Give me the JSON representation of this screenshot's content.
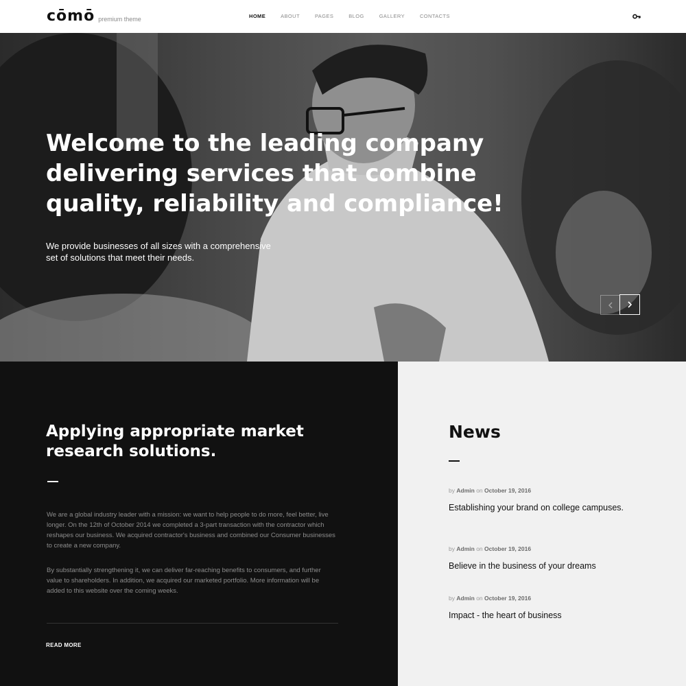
{
  "header": {
    "logo_text": "cōmō",
    "logo_tagline": "premium theme",
    "nav": [
      {
        "label": "HOME",
        "active": true
      },
      {
        "label": "ABOUT",
        "active": false
      },
      {
        "label": "PAGES",
        "active": false
      },
      {
        "label": "BLOG",
        "active": false
      },
      {
        "label": "GALLERY",
        "active": false
      },
      {
        "label": "CONTACTS",
        "active": false
      }
    ],
    "login_icon": "key-icon"
  },
  "hero": {
    "title": "Welcome to the leading company delivering services that combine quality, reliability and compliance!",
    "subtitle": "We provide businesses of all sizes with a comprehensive set of solutions that meet their needs.",
    "prev_icon": "chevron-left-icon",
    "next_icon": "chevron-right-icon"
  },
  "about": {
    "title": "Applying appropriate market research solutions.",
    "paragraph_1": "We are a global industry leader with a mission: we want to help people to do more, feel better, live longer. On the 12th of October 2014 we completed a 3-part transaction with the contractor which reshapes our business. We acquired contractor's business and combined our Consumer businesses to create a new company.",
    "paragraph_2": "By substantially strengthening it, we can deliver far-reaching benefits to consumers, and further value to shareholders. In addition, we acquired our marketed portfolio. More information will be added to this website over the coming weeks.",
    "read_more": "READ MORE"
  },
  "news": {
    "title": "News",
    "items": [
      {
        "by": "by",
        "author": "Admin",
        "on": "on",
        "date": "October 19, 2016",
        "headline": "Establishing your brand on college campuses."
      },
      {
        "by": "by",
        "author": "Admin",
        "on": "on",
        "date": "October 19, 2016",
        "headline": "Believe in the business of your dreams"
      },
      {
        "by": "by",
        "author": "Admin",
        "on": "on",
        "date": "October 19, 2016",
        "headline": "Impact - the heart of business"
      }
    ]
  },
  "colors": {
    "dark_section": "#111111",
    "news_section": "#f1f1f1",
    "accent": "#ffffff"
  }
}
